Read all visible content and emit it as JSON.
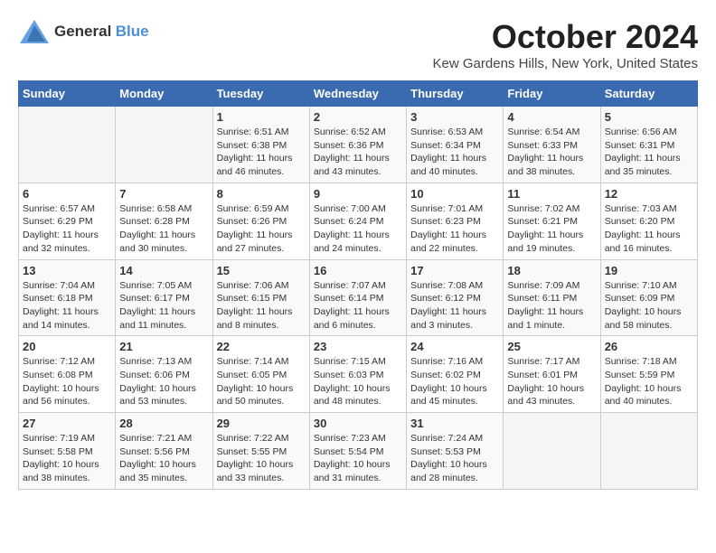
{
  "logo": {
    "text_general": "General",
    "text_blue": "Blue"
  },
  "title": {
    "month": "October 2024",
    "location": "Kew Gardens Hills, New York, United States"
  },
  "headers": [
    "Sunday",
    "Monday",
    "Tuesday",
    "Wednesday",
    "Thursday",
    "Friday",
    "Saturday"
  ],
  "weeks": [
    [
      {
        "day": "",
        "sunrise": "",
        "sunset": "",
        "daylight": ""
      },
      {
        "day": "",
        "sunrise": "",
        "sunset": "",
        "daylight": ""
      },
      {
        "day": "1",
        "sunrise": "Sunrise: 6:51 AM",
        "sunset": "Sunset: 6:38 PM",
        "daylight": "Daylight: 11 hours and 46 minutes."
      },
      {
        "day": "2",
        "sunrise": "Sunrise: 6:52 AM",
        "sunset": "Sunset: 6:36 PM",
        "daylight": "Daylight: 11 hours and 43 minutes."
      },
      {
        "day": "3",
        "sunrise": "Sunrise: 6:53 AM",
        "sunset": "Sunset: 6:34 PM",
        "daylight": "Daylight: 11 hours and 40 minutes."
      },
      {
        "day": "4",
        "sunrise": "Sunrise: 6:54 AM",
        "sunset": "Sunset: 6:33 PM",
        "daylight": "Daylight: 11 hours and 38 minutes."
      },
      {
        "day": "5",
        "sunrise": "Sunrise: 6:56 AM",
        "sunset": "Sunset: 6:31 PM",
        "daylight": "Daylight: 11 hours and 35 minutes."
      }
    ],
    [
      {
        "day": "6",
        "sunrise": "Sunrise: 6:57 AM",
        "sunset": "Sunset: 6:29 PM",
        "daylight": "Daylight: 11 hours and 32 minutes."
      },
      {
        "day": "7",
        "sunrise": "Sunrise: 6:58 AM",
        "sunset": "Sunset: 6:28 PM",
        "daylight": "Daylight: 11 hours and 30 minutes."
      },
      {
        "day": "8",
        "sunrise": "Sunrise: 6:59 AM",
        "sunset": "Sunset: 6:26 PM",
        "daylight": "Daylight: 11 hours and 27 minutes."
      },
      {
        "day": "9",
        "sunrise": "Sunrise: 7:00 AM",
        "sunset": "Sunset: 6:24 PM",
        "daylight": "Daylight: 11 hours and 24 minutes."
      },
      {
        "day": "10",
        "sunrise": "Sunrise: 7:01 AM",
        "sunset": "Sunset: 6:23 PM",
        "daylight": "Daylight: 11 hours and 22 minutes."
      },
      {
        "day": "11",
        "sunrise": "Sunrise: 7:02 AM",
        "sunset": "Sunset: 6:21 PM",
        "daylight": "Daylight: 11 hours and 19 minutes."
      },
      {
        "day": "12",
        "sunrise": "Sunrise: 7:03 AM",
        "sunset": "Sunset: 6:20 PM",
        "daylight": "Daylight: 11 hours and 16 minutes."
      }
    ],
    [
      {
        "day": "13",
        "sunrise": "Sunrise: 7:04 AM",
        "sunset": "Sunset: 6:18 PM",
        "daylight": "Daylight: 11 hours and 14 minutes."
      },
      {
        "day": "14",
        "sunrise": "Sunrise: 7:05 AM",
        "sunset": "Sunset: 6:17 PM",
        "daylight": "Daylight: 11 hours and 11 minutes."
      },
      {
        "day": "15",
        "sunrise": "Sunrise: 7:06 AM",
        "sunset": "Sunset: 6:15 PM",
        "daylight": "Daylight: 11 hours and 8 minutes."
      },
      {
        "day": "16",
        "sunrise": "Sunrise: 7:07 AM",
        "sunset": "Sunset: 6:14 PM",
        "daylight": "Daylight: 11 hours and 6 minutes."
      },
      {
        "day": "17",
        "sunrise": "Sunrise: 7:08 AM",
        "sunset": "Sunset: 6:12 PM",
        "daylight": "Daylight: 11 hours and 3 minutes."
      },
      {
        "day": "18",
        "sunrise": "Sunrise: 7:09 AM",
        "sunset": "Sunset: 6:11 PM",
        "daylight": "Daylight: 11 hours and 1 minute."
      },
      {
        "day": "19",
        "sunrise": "Sunrise: 7:10 AM",
        "sunset": "Sunset: 6:09 PM",
        "daylight": "Daylight: 10 hours and 58 minutes."
      }
    ],
    [
      {
        "day": "20",
        "sunrise": "Sunrise: 7:12 AM",
        "sunset": "Sunset: 6:08 PM",
        "daylight": "Daylight: 10 hours and 56 minutes."
      },
      {
        "day": "21",
        "sunrise": "Sunrise: 7:13 AM",
        "sunset": "Sunset: 6:06 PM",
        "daylight": "Daylight: 10 hours and 53 minutes."
      },
      {
        "day": "22",
        "sunrise": "Sunrise: 7:14 AM",
        "sunset": "Sunset: 6:05 PM",
        "daylight": "Daylight: 10 hours and 50 minutes."
      },
      {
        "day": "23",
        "sunrise": "Sunrise: 7:15 AM",
        "sunset": "Sunset: 6:03 PM",
        "daylight": "Daylight: 10 hours and 48 minutes."
      },
      {
        "day": "24",
        "sunrise": "Sunrise: 7:16 AM",
        "sunset": "Sunset: 6:02 PM",
        "daylight": "Daylight: 10 hours and 45 minutes."
      },
      {
        "day": "25",
        "sunrise": "Sunrise: 7:17 AM",
        "sunset": "Sunset: 6:01 PM",
        "daylight": "Daylight: 10 hours and 43 minutes."
      },
      {
        "day": "26",
        "sunrise": "Sunrise: 7:18 AM",
        "sunset": "Sunset: 5:59 PM",
        "daylight": "Daylight: 10 hours and 40 minutes."
      }
    ],
    [
      {
        "day": "27",
        "sunrise": "Sunrise: 7:19 AM",
        "sunset": "Sunset: 5:58 PM",
        "daylight": "Daylight: 10 hours and 38 minutes."
      },
      {
        "day": "28",
        "sunrise": "Sunrise: 7:21 AM",
        "sunset": "Sunset: 5:56 PM",
        "daylight": "Daylight: 10 hours and 35 minutes."
      },
      {
        "day": "29",
        "sunrise": "Sunrise: 7:22 AM",
        "sunset": "Sunset: 5:55 PM",
        "daylight": "Daylight: 10 hours and 33 minutes."
      },
      {
        "day": "30",
        "sunrise": "Sunrise: 7:23 AM",
        "sunset": "Sunset: 5:54 PM",
        "daylight": "Daylight: 10 hours and 31 minutes."
      },
      {
        "day": "31",
        "sunrise": "Sunrise: 7:24 AM",
        "sunset": "Sunset: 5:53 PM",
        "daylight": "Daylight: 10 hours and 28 minutes."
      },
      {
        "day": "",
        "sunrise": "",
        "sunset": "",
        "daylight": ""
      },
      {
        "day": "",
        "sunrise": "",
        "sunset": "",
        "daylight": ""
      }
    ]
  ]
}
